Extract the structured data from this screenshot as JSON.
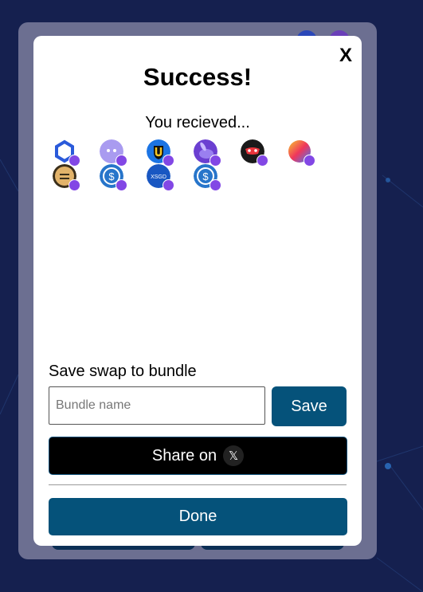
{
  "modal": {
    "close_label": "X",
    "title": "Success!",
    "subtitle": "You recieved..."
  },
  "tokens": [
    {
      "icon": "chainlink-token-icon"
    },
    {
      "icon": "ghost-token-icon"
    },
    {
      "icon": "shield-u-token-icon"
    },
    {
      "icon": "rabbit-token-icon"
    },
    {
      "icon": "mask-token-icon"
    },
    {
      "icon": "rainbow-token-icon"
    },
    {
      "icon": "gold-coin-token-icon"
    },
    {
      "icon": "usdc-token-icon"
    },
    {
      "icon": "xsgd-token-icon"
    },
    {
      "icon": "usdc-alt-token-icon"
    }
  ],
  "bundle": {
    "label": "Save swap to bundle",
    "placeholder": "Bundle name",
    "save_label": "Save"
  },
  "share": {
    "label": "Share on",
    "x_glyph": "𝕏"
  },
  "done_label": "Done",
  "colors": {
    "primary": "#05527a",
    "polygon_badge": "#8247e5",
    "page_bg": "#15204f"
  }
}
